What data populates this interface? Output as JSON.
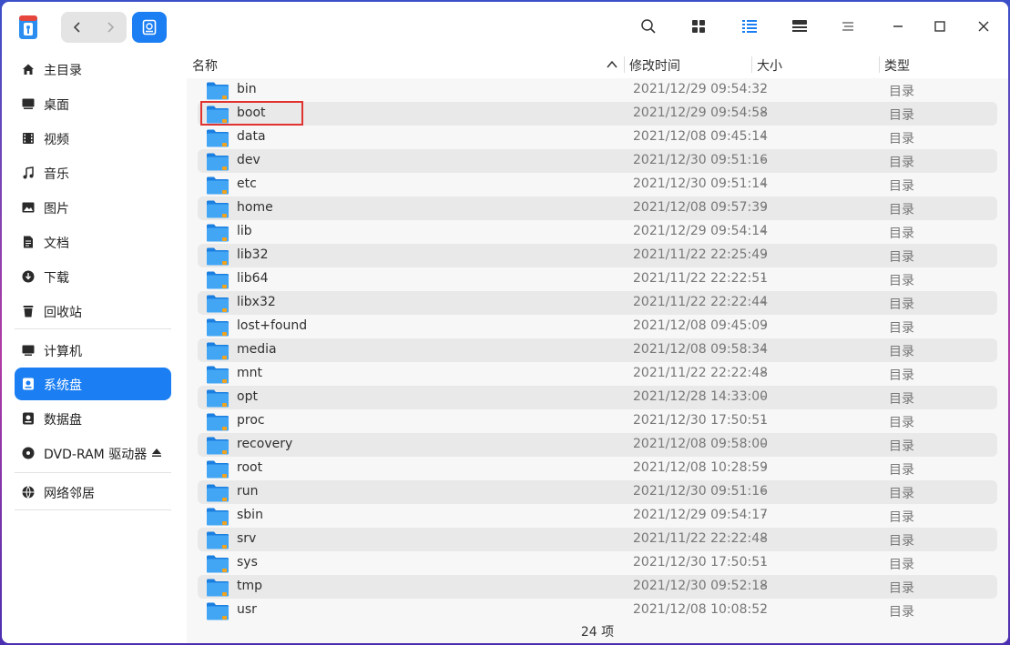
{
  "colors": {
    "accent": "#1b7ef2",
    "highlight_box": "#e0322e",
    "folder": "#2f93f0"
  },
  "titlebar": {
    "icons": [
      "app-logo-icon",
      "back-icon",
      "forward-icon",
      "disk-icon",
      "search-icon",
      "grid-view-icon",
      "list-view-icon",
      "detail-view-icon",
      "menu-icon",
      "minimize-icon",
      "maximize-icon",
      "close-icon"
    ]
  },
  "sidebar": {
    "items": [
      {
        "label": "主目录",
        "icon": "home-icon"
      },
      {
        "label": "桌面",
        "icon": "desktop-icon"
      },
      {
        "label": "视频",
        "icon": "video-icon"
      },
      {
        "label": "音乐",
        "icon": "music-icon"
      },
      {
        "label": "图片",
        "icon": "picture-icon"
      },
      {
        "label": "文档",
        "icon": "document-icon"
      },
      {
        "label": "下载",
        "icon": "download-icon"
      },
      {
        "label": "回收站",
        "icon": "trash-icon"
      },
      {
        "label": "计算机",
        "icon": "computer-icon"
      },
      {
        "label": "系统盘",
        "icon": "system-disk-icon",
        "active": true
      },
      {
        "label": "数据盘",
        "icon": "data-disk-icon"
      },
      {
        "label": "DVD-RAM 驱动器",
        "icon": "dvd-icon"
      },
      {
        "label": "网络邻居",
        "icon": "network-icon"
      }
    ]
  },
  "table": {
    "columns": {
      "name": "名称",
      "modified": "修改时间",
      "size": "大小",
      "type": "类型"
    },
    "rows": [
      {
        "name": "bin",
        "modified": "2021/12/29 09:54:32",
        "size": "-",
        "type": "目录"
      },
      {
        "name": "boot",
        "modified": "2021/12/29 09:54:58",
        "size": "-",
        "type": "目录"
      },
      {
        "name": "data",
        "modified": "2021/12/08 09:45:14",
        "size": "-",
        "type": "目录"
      },
      {
        "name": "dev",
        "modified": "2021/12/30 09:51:16",
        "size": "-",
        "type": "目录"
      },
      {
        "name": "etc",
        "modified": "2021/12/30 09:51:14",
        "size": "-",
        "type": "目录"
      },
      {
        "name": "home",
        "modified": "2021/12/08 09:57:39",
        "size": "-",
        "type": "目录"
      },
      {
        "name": "lib",
        "modified": "2021/12/29 09:54:14",
        "size": "-",
        "type": "目录"
      },
      {
        "name": "lib32",
        "modified": "2021/11/22 22:25:49",
        "size": "-",
        "type": "目录"
      },
      {
        "name": "lib64",
        "modified": "2021/11/22 22:22:51",
        "size": "-",
        "type": "目录"
      },
      {
        "name": "libx32",
        "modified": "2021/11/22 22:22:44",
        "size": "-",
        "type": "目录"
      },
      {
        "name": "lost+found",
        "modified": "2021/12/08 09:45:09",
        "size": "-",
        "type": "目录"
      },
      {
        "name": "media",
        "modified": "2021/12/08 09:58:34",
        "size": "-",
        "type": "目录"
      },
      {
        "name": "mnt",
        "modified": "2021/11/22 22:22:48",
        "size": "-",
        "type": "目录"
      },
      {
        "name": "opt",
        "modified": "2021/12/28 14:33:00",
        "size": "-",
        "type": "目录"
      },
      {
        "name": "proc",
        "modified": "2021/12/30 17:50:51",
        "size": "-",
        "type": "目录"
      },
      {
        "name": "recovery",
        "modified": "2021/12/08 09:58:00",
        "size": "-",
        "type": "目录"
      },
      {
        "name": "root",
        "modified": "2021/12/08 10:28:59",
        "size": "-",
        "type": "目录"
      },
      {
        "name": "run",
        "modified": "2021/12/30 09:51:16",
        "size": "-",
        "type": "目录"
      },
      {
        "name": "sbin",
        "modified": "2021/12/29 09:54:17",
        "size": "-",
        "type": "目录"
      },
      {
        "name": "srv",
        "modified": "2021/11/22 22:22:48",
        "size": "-",
        "type": "目录"
      },
      {
        "name": "sys",
        "modified": "2021/12/30 17:50:51",
        "size": "-",
        "type": "目录"
      },
      {
        "name": "tmp",
        "modified": "2021/12/30 09:52:18",
        "size": "-",
        "type": "目录"
      },
      {
        "name": "usr",
        "modified": "2021/12/08 10:08:52",
        "size": "-",
        "type": "目录"
      }
    ]
  },
  "status": {
    "count": "24 项"
  }
}
